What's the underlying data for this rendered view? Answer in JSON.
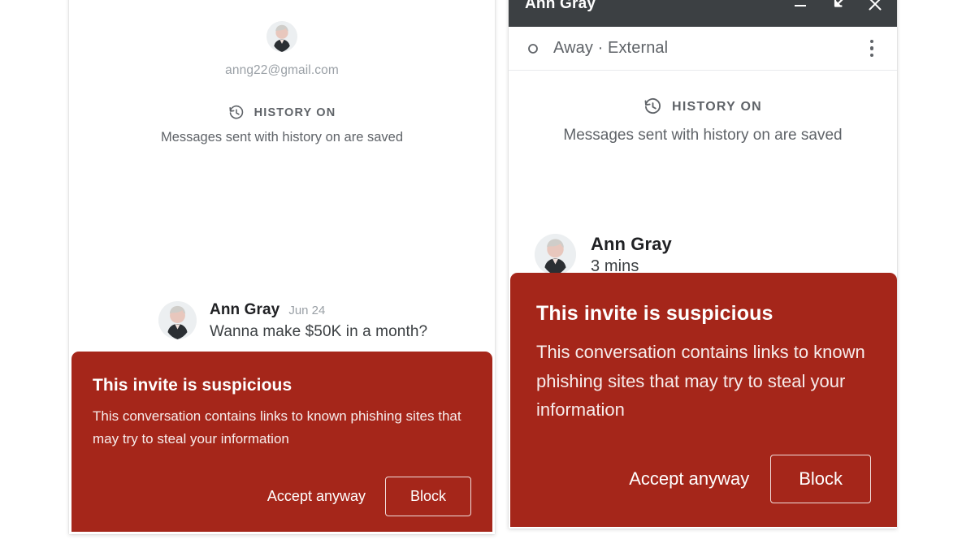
{
  "mobile_panel": {
    "profile": {
      "avatar_icon": "user-avatar-photo",
      "email": "anng22@gmail.com"
    },
    "history_notice": {
      "icon": "history-clock-icon",
      "label": "HISTORY ON",
      "description": "Messages sent with history on are saved"
    },
    "message": {
      "avatar_icon": "user-avatar-photo",
      "sender": "Ann Gray",
      "timestamp": "Jun 24",
      "body": "Wanna make $50K in a month?"
    },
    "warning": {
      "title": "This invite is suspicious",
      "body": "This conversation contains links to known phishing sites that may try to steal your information",
      "accept_label": "Accept anyway",
      "block_label": "Block",
      "background_color": "#a5261a",
      "text_color": "#ffffff"
    }
  },
  "desktop_panel": {
    "titlebar": {
      "title": "Ann Gray",
      "background_color": "#3c4043",
      "minimize_icon": "minimize-icon",
      "popout_icon": "pop-out-icon",
      "close_icon": "close-icon"
    },
    "statusbar": {
      "status_icon": "away-circle-icon",
      "status_text": "Away · External",
      "overflow_icon": "more-vertical-icon"
    },
    "history_notice": {
      "icon": "history-clock-icon",
      "label": "HISTORY ON",
      "description": "Messages sent with history on are saved"
    },
    "message": {
      "avatar_icon": "user-avatar-photo",
      "sender": "Ann Gray",
      "timestamp": "3 mins"
    },
    "warning": {
      "title": "This invite is suspicious",
      "body": "This conversation contains links to known phishing sites that may try to steal your information",
      "accept_label": "Accept anyway",
      "block_label": "Block",
      "background_color": "#a5261a",
      "text_color": "#ffffff"
    }
  }
}
